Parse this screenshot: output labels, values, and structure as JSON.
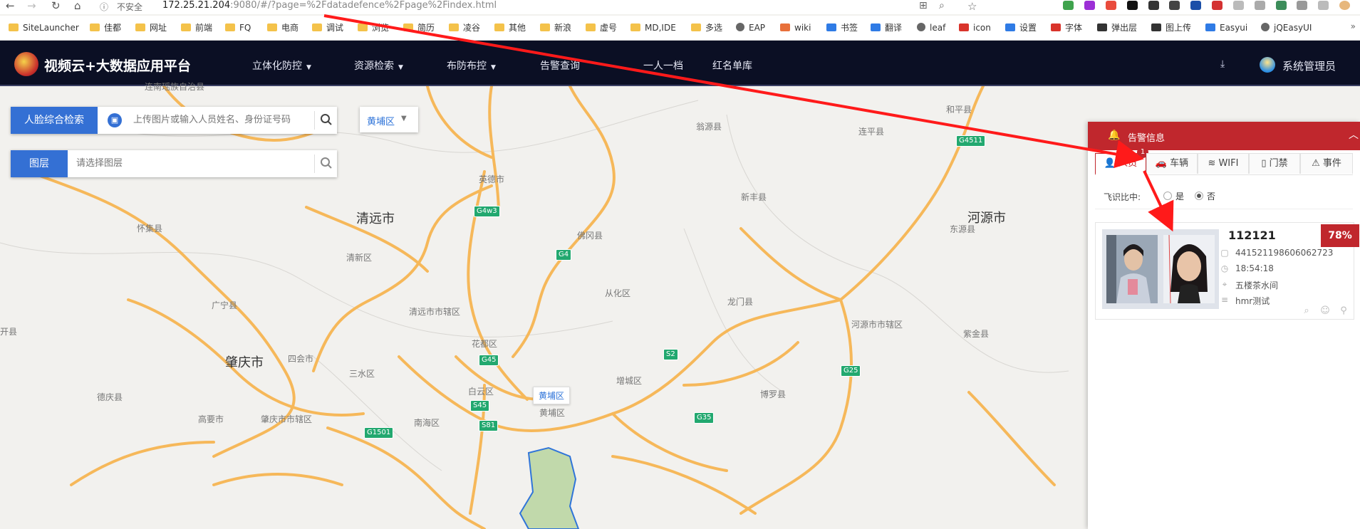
{
  "browser": {
    "url_security": "不安全",
    "url_host": "172.25.21.204",
    "url_rest": ":9080/#/?page=%2Fdatadefence%2Fpage%2Findex.html",
    "bookmarks": [
      "SiteLauncher",
      "佳都",
      "网址",
      "前端",
      "FQ",
      "电商",
      "调试",
      "浏览",
      "简历",
      "凌谷",
      "其他",
      "新浪",
      "虚号",
      "MD,IDE",
      "多选",
      "EAP",
      "wiki",
      "书签",
      "翻译",
      "leaf",
      "icon",
      "设置",
      "字体",
      "弹出层",
      "图上传",
      "Easyui",
      "jQEasyUI"
    ]
  },
  "app": {
    "title": "视频云+大数据应用平台",
    "nav": [
      {
        "label": "立体化防控",
        "caret": true
      },
      {
        "label": "资源检索",
        "caret": true
      },
      {
        "label": "布防布控",
        "caret": true
      },
      {
        "label": "告警查询",
        "caret": false
      },
      {
        "label": "一人一档",
        "caret": false
      },
      {
        "label": "红名单库",
        "caret": false
      }
    ],
    "user": "系统管理员"
  },
  "search": {
    "face_button": "人脸综合检索",
    "face_placeholder": "上传图片或输入人员姓名、身份证号码",
    "layer_button": "图层",
    "layer_placeholder": "请选择图层",
    "district": "黄埔区"
  },
  "map": {
    "cities": [
      "清远市",
      "河源市",
      "肇庆市"
    ],
    "places": [
      "连南瑶族自治县",
      "翁源县",
      "和平县",
      "连平县",
      "英德市",
      "新丰县",
      "怀集县",
      "佛冈县",
      "东源县",
      "清新区",
      "从化区",
      "广宁县",
      "龙门县",
      "清远市市辖区",
      "河源市市辖区",
      "开县",
      "花都区",
      "紫金县",
      "四会市",
      "三水区",
      "增城区",
      "德庆县",
      "白云区",
      "博罗县",
      "高要市",
      "肇庆市市辖区",
      "南海区",
      "黄埔区"
    ],
    "highways": [
      "G4511",
      "G4w3",
      "G4",
      "S2",
      "G45",
      "G25",
      "S45",
      "G35",
      "S81",
      "G1501"
    ],
    "district_popup": "黄埔区"
  },
  "alarm": {
    "title": "告警信息",
    "tabs": [
      {
        "label": "人员",
        "badge": "1",
        "active": true
      },
      {
        "label": "车辆",
        "active": false
      },
      {
        "label": "WIFI",
        "active": false
      },
      {
        "label": "门禁",
        "active": false
      },
      {
        "label": "事件",
        "active": false
      }
    ],
    "filter_label": "飞识比中:",
    "filter_yes": "是",
    "filter_no": "否",
    "filter_selected": "否",
    "card": {
      "id": "112121",
      "match": "78%",
      "id_number": "441521198606062723",
      "time": "18:54:18",
      "location": "五楼茶水间",
      "library": "hmr测试"
    }
  },
  "colors": {
    "header_bg": "#0b0f24",
    "primary_blue": "#3470d4",
    "alarm_red": "#c0272d",
    "annotation_arrow": "#ff1a1a",
    "road": "#f6b85a",
    "district_fill": "#b4d39a"
  }
}
